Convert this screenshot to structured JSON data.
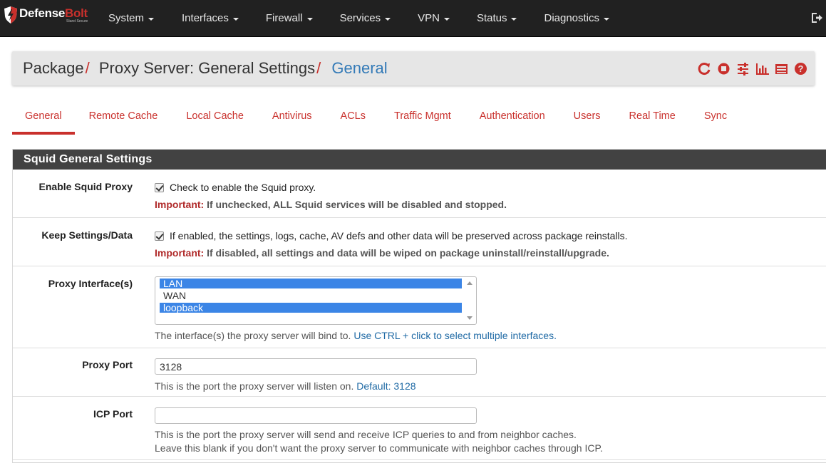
{
  "brand": {
    "name_main": "Defense",
    "name_accent": "Bolt",
    "tagline": "Stand Secure"
  },
  "nav": {
    "items": [
      {
        "label": "System"
      },
      {
        "label": "Interfaces"
      },
      {
        "label": "Firewall"
      },
      {
        "label": "Services"
      },
      {
        "label": "VPN"
      },
      {
        "label": "Status"
      },
      {
        "label": "Diagnostics"
      }
    ],
    "logout_icon": "logout-icon"
  },
  "breadcrumb": {
    "items": [
      "Package",
      "Proxy Server: General Settings",
      "General"
    ],
    "separator": "/",
    "icons": [
      "restart-service-icon",
      "stop-service-icon",
      "settings-sliders-icon",
      "chart-icon",
      "log-icon",
      "help-icon"
    ]
  },
  "tabs": [
    {
      "label": "General",
      "active": true
    },
    {
      "label": "Remote Cache"
    },
    {
      "label": "Local Cache"
    },
    {
      "label": "Antivirus"
    },
    {
      "label": "ACLs"
    },
    {
      "label": "Traffic Mgmt"
    },
    {
      "label": "Authentication"
    },
    {
      "label": "Users"
    },
    {
      "label": "Real Time"
    },
    {
      "label": "Sync"
    }
  ],
  "panel": {
    "title": "Squid General Settings",
    "fields": {
      "enable": {
        "label": "Enable Squid Proxy",
        "checked": true,
        "checkbox_text": "Check to enable the Squid proxy.",
        "important_prefix": "Important:",
        "important_text": " If unchecked, ALL Squid services will be disabled and stopped."
      },
      "keep": {
        "label": "Keep Settings/Data",
        "checked": true,
        "checkbox_text": "If enabled, the settings, logs, cache, AV defs and other data will be preserved across package reinstalls.",
        "important_prefix": "Important:",
        "important_text": " If disabled, all settings and data will be wiped on package uninstall/reinstall/upgrade."
      },
      "interfaces": {
        "label": "Proxy Interface(s)",
        "options": [
          {
            "label": "LAN",
            "selected": true
          },
          {
            "label": "WAN",
            "selected": false
          },
          {
            "label": "loopback",
            "selected": true
          }
        ],
        "help_text": "The interface(s) the proxy server will bind to. ",
        "help_link": "Use CTRL + click to select multiple interfaces."
      },
      "port": {
        "label": "Proxy Port",
        "value": "3128",
        "help_text": "This is the port the proxy server will listen on. ",
        "help_link": "Default: 3128"
      },
      "icp": {
        "label": "ICP Port",
        "value": "",
        "help_line1": "This is the port the proxy server will send and receive ICP queries to and from neighbor caches.",
        "help_line2": "Leave this blank if you don't want the proxy server to communicate with neighbor caches through ICP."
      }
    }
  },
  "colors": {
    "navbar_bg": "#212121",
    "accent_red": "#c9302c",
    "link_blue": "#337ab7",
    "panel_head_bg": "#424242",
    "select_blue": "#3b85e6"
  }
}
